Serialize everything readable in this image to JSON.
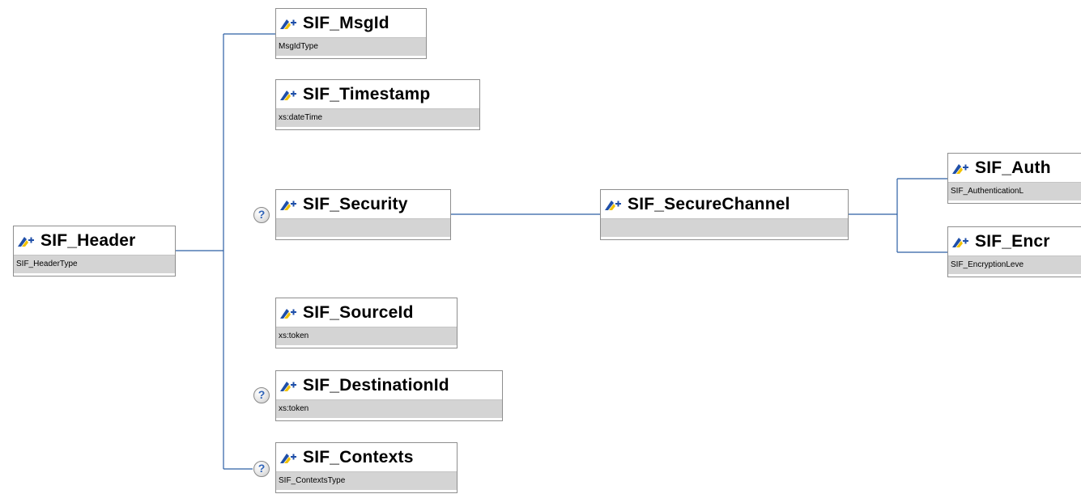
{
  "colors": {
    "connector": "#2c5fa5",
    "node_border": "#8e8e8e",
    "type_band": "#d4d4d4",
    "optional_badge_glyph": "#2f63b8",
    "element_icon_blue": "#1f4fa8",
    "element_icon_yellow": "#f2c200"
  },
  "icons": {
    "element": "element-icon",
    "optional": "optional-question-icon"
  },
  "optional_badge_glyph": "?",
  "nodes": {
    "header": {
      "name": "SIF_Header",
      "type": "SIF_HeaderType"
    },
    "msgid": {
      "name": "SIF_MsgId",
      "type": "MsgIdType"
    },
    "timestamp": {
      "name": "SIF_Timestamp",
      "type": "xs:dateTime"
    },
    "security": {
      "name": "SIF_Security",
      "type": "",
      "optional": true
    },
    "sourceid": {
      "name": "SIF_SourceId",
      "type": "xs:token"
    },
    "destinationid": {
      "name": "SIF_DestinationId",
      "type": "xs:token",
      "optional": true
    },
    "contexts": {
      "name": "SIF_Contexts",
      "type": "SIF_ContextsType",
      "optional": true
    },
    "securechannel": {
      "name": "SIF_SecureChannel",
      "type": ""
    },
    "auth": {
      "name": "SIF_Auth",
      "type": "SIF_AuthenticationL"
    },
    "encr": {
      "name": "SIF_Encr",
      "type": "SIF_EncryptionLeve"
    }
  }
}
